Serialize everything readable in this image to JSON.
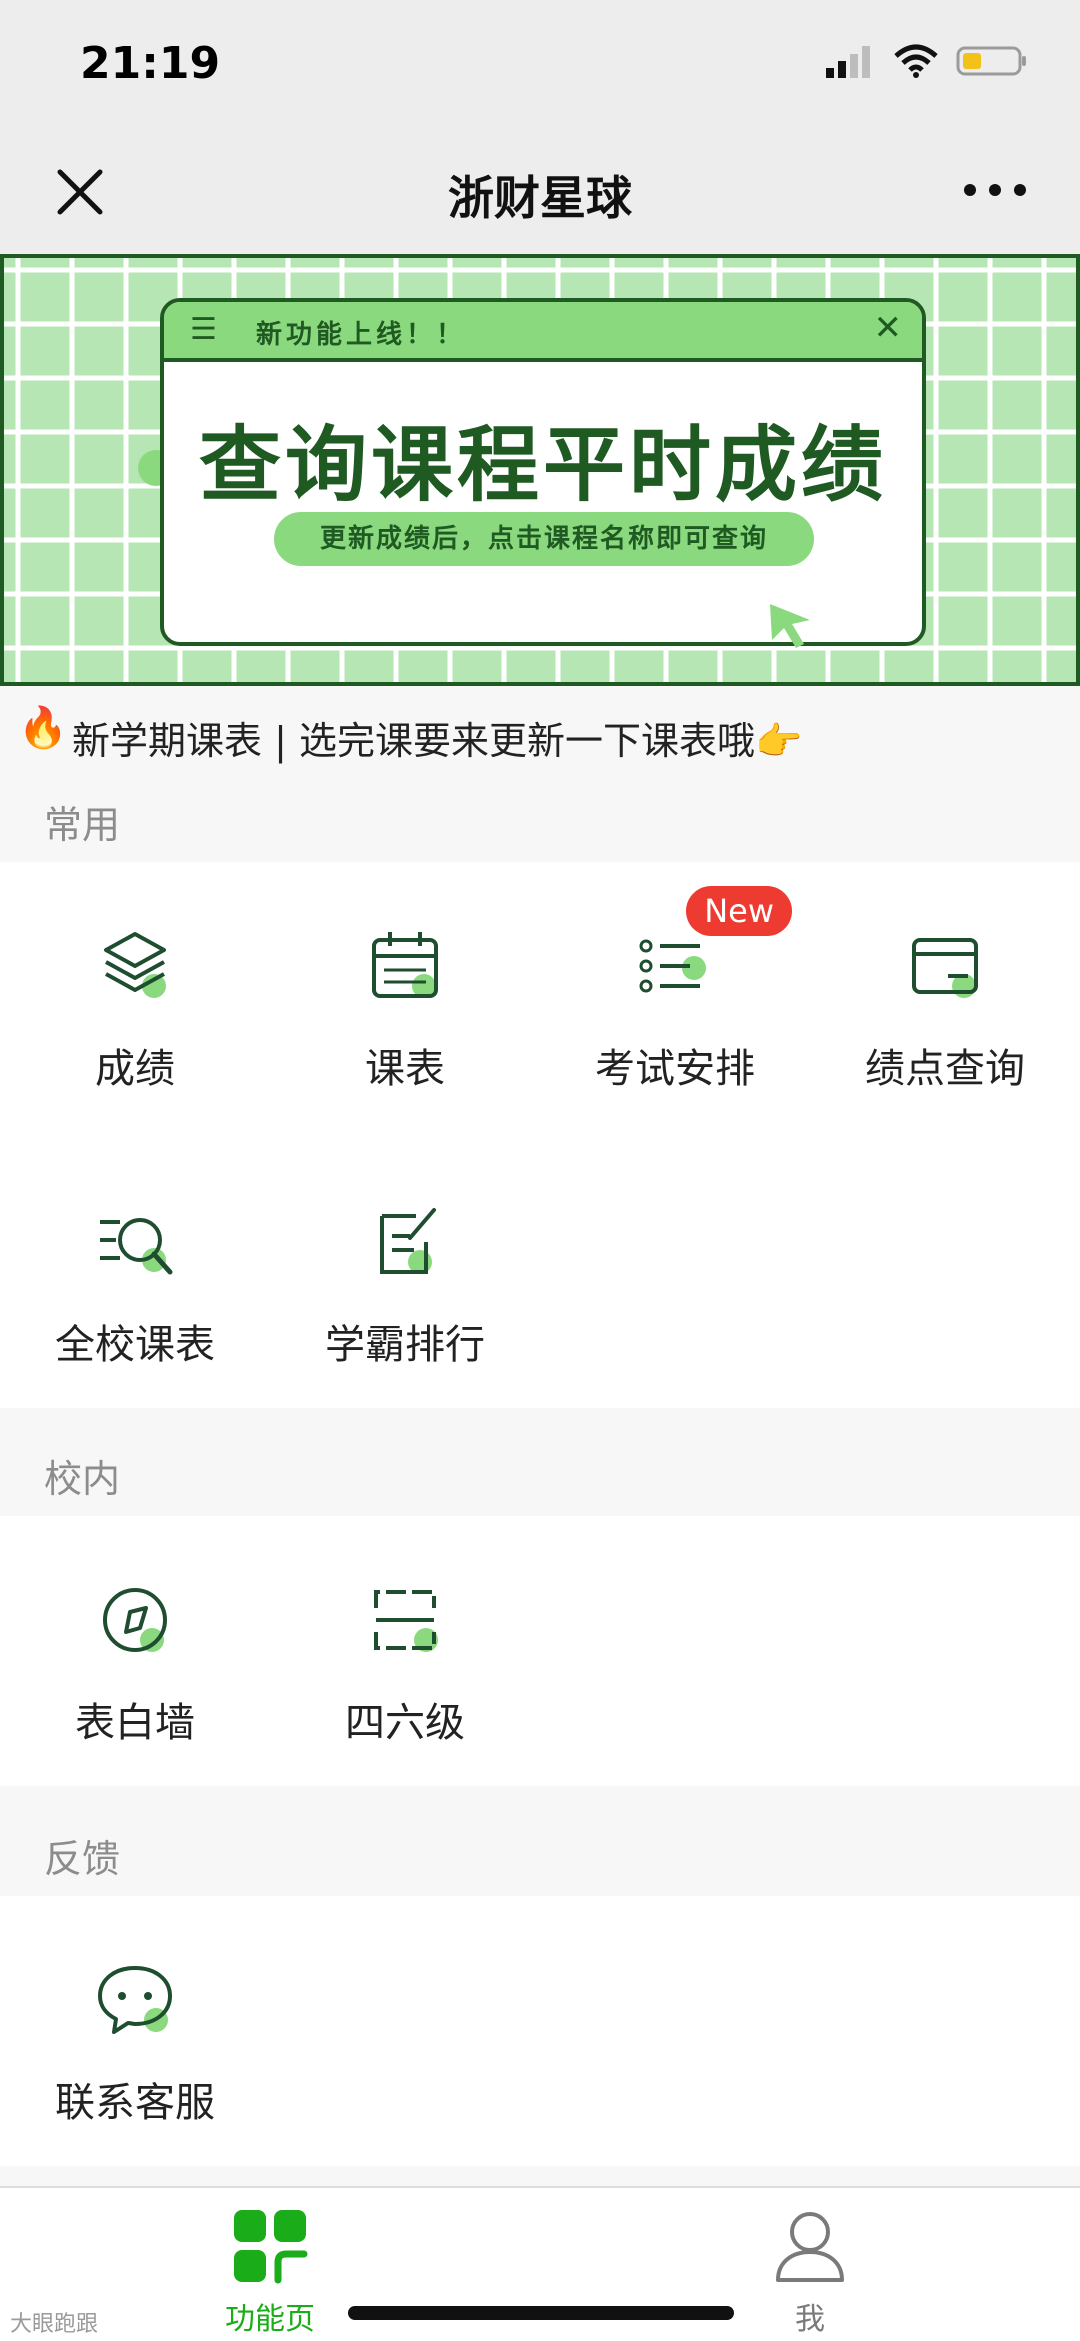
{
  "status": {
    "time": "21:19"
  },
  "nav": {
    "title": "浙财星球"
  },
  "banner": {
    "tag": "新功能上线！！",
    "title": "查询课程平时成绩",
    "subtitle": "更新成绩后，点击课程名称即可查询"
  },
  "notice": {
    "text": "新学期课表 | 选完课要来更新一下课表哦👉"
  },
  "sections": {
    "common": {
      "title": "常用",
      "items": [
        {
          "label": "成绩",
          "icon": "stack-icon"
        },
        {
          "label": "课表",
          "icon": "calendar-icon"
        },
        {
          "label": "考试安排",
          "icon": "list-icon",
          "badge": "New"
        },
        {
          "label": "绩点查询",
          "icon": "card-icon"
        },
        {
          "label": "全校课表",
          "icon": "search-list-icon"
        },
        {
          "label": "学霸排行",
          "icon": "edit-note-icon"
        }
      ]
    },
    "campus": {
      "title": "校内",
      "items": [
        {
          "label": "表白墙",
          "icon": "compass-icon"
        },
        {
          "label": "四六级",
          "icon": "scan-icon"
        }
      ]
    },
    "feedback": {
      "title": "反馈",
      "items": [
        {
          "label": "联系客服",
          "icon": "chat-icon"
        }
      ]
    }
  },
  "tabs": {
    "home": {
      "label": "功能页",
      "color": "#1aad19"
    },
    "me": {
      "label": "我",
      "color": "#7a7a7a"
    }
  },
  "watermark": "大眼跑跟"
}
